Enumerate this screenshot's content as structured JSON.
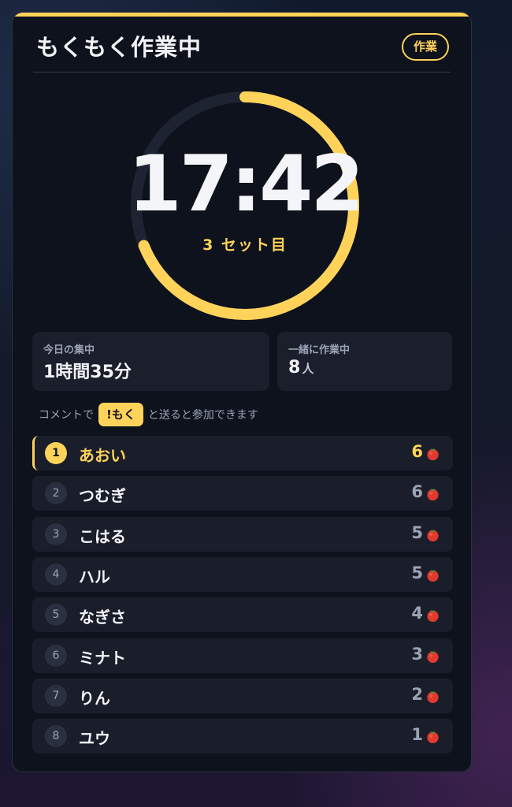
{
  "header": {
    "title": "もくもく作業中",
    "mode_badge": "作業"
  },
  "timer": {
    "time": "17:42",
    "set_label": "3 セット目",
    "progress": 0.69,
    "accent": "#ffd35a"
  },
  "stats": {
    "focus": {
      "label": "今日の集中",
      "value": "1時間35分"
    },
    "together": {
      "label": "一緒に作業中",
      "value": "8",
      "unit": "人"
    }
  },
  "hint": {
    "before": "コメントで",
    "command": "!もく",
    "after": "と送ると参加できます"
  },
  "ranking": [
    {
      "rank": "1",
      "name": "あおい",
      "count": "6"
    },
    {
      "rank": "2",
      "name": "つむぎ",
      "count": "6"
    },
    {
      "rank": "3",
      "name": "こはる",
      "count": "5"
    },
    {
      "rank": "4",
      "name": "ハル",
      "count": "5"
    },
    {
      "rank": "5",
      "name": "なぎさ",
      "count": "4"
    },
    {
      "rank": "6",
      "name": "ミナト",
      "count": "3"
    },
    {
      "rank": "7",
      "name": "りん",
      "count": "2"
    },
    {
      "rank": "8",
      "name": "ユウ",
      "count": "1"
    }
  ],
  "icons": {
    "count_icon": "tomato-icon"
  }
}
